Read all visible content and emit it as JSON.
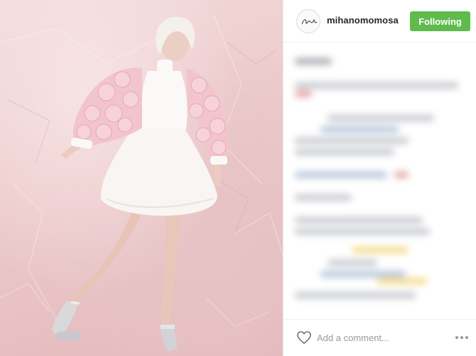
{
  "post": {
    "photo_icon": "photo-of-woman-in-pink-rose-jacket-and-white-dress"
  },
  "header": {
    "username": "mihanomomosa",
    "follow_label": "Following",
    "avatar_icon": "signature-avatar-icon"
  },
  "caption": {
    "blurred": true
  },
  "footer": {
    "comment_placeholder": "Add a comment...",
    "like_icon": "heart-icon",
    "more_icon": "more-options-icon"
  },
  "colors": {
    "follow_button": "#5fbb4e",
    "username": "#262626",
    "placeholder": "#999999",
    "border": "#efefef"
  }
}
